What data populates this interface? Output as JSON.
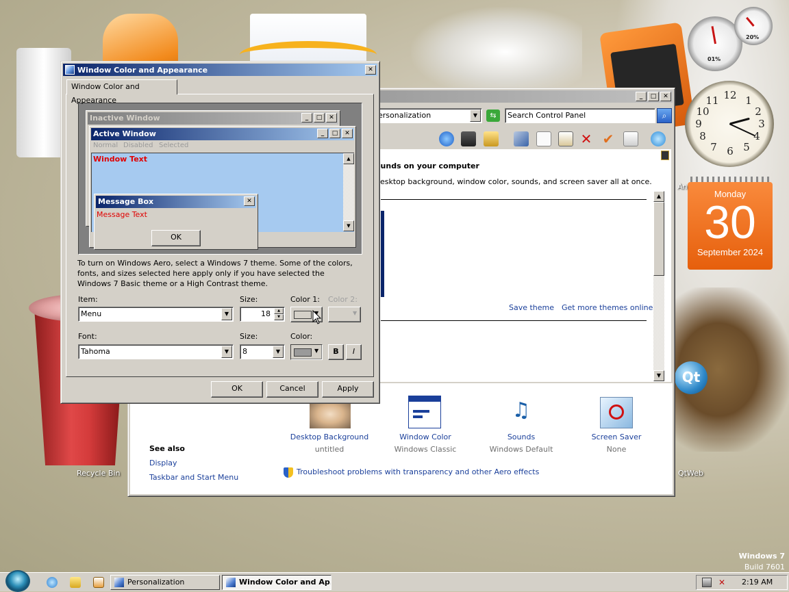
{
  "desktop": {
    "icons": [
      {
        "label": "Recycle Bin"
      },
      {
        "label": "QtWeb"
      }
    ],
    "partial_label": "An",
    "watermark": {
      "line1": "Windows 7",
      "line2": "Build 7601"
    }
  },
  "gadgets": {
    "cpu_percent": "01%",
    "memory_percent": "20%",
    "clock": {
      "numerals": [
        "12",
        "1",
        "2",
        "3",
        "4",
        "5",
        "6",
        "7",
        "8",
        "9",
        "10",
        "11"
      ]
    },
    "calendar": {
      "weekday": "Monday",
      "day": "30",
      "month_year": "September 2024"
    }
  },
  "personalization": {
    "address_text": "ersonalization",
    "search_placeholder": "Search Control Panel",
    "heading": "ounds on your computer",
    "subtext": "desktop background, window color, sounds, and screen saver all at once.",
    "save_theme": "Save theme",
    "get_more_themes": "Get more themes online",
    "items": [
      {
        "label": "Desktop Background",
        "sub": "untitled"
      },
      {
        "label": "Window Color",
        "sub": "Windows Classic"
      },
      {
        "label": "Sounds",
        "sub": "Windows Default"
      },
      {
        "label": "Screen Saver",
        "sub": "None"
      }
    ],
    "see_also_title": "See also",
    "see_also_links": [
      "Display",
      "Taskbar and Start Menu"
    ],
    "troubleshoot": "Troubleshoot problems with transparency and other Aero effects"
  },
  "dialog": {
    "title": "Window Color and Appearance",
    "tab": "Window Color and Appearance",
    "preview": {
      "inactive_title": "Inactive Window",
      "active_title": "Active Window",
      "menu": [
        "Normal",
        "Disabled",
        "Selected"
      ],
      "window_text": "Window Text",
      "msgbox_title": "Message Box",
      "msgbox_text": "Message Text",
      "msgbox_ok": "OK"
    },
    "description": "To turn on Windows Aero, select a Windows 7 theme.  Some of the colors, fonts, and sizes selected here apply only if you have selected the Windows 7 Basic theme or a High Contrast theme.",
    "labels": {
      "item": "Item:",
      "size": "Size:",
      "color1": "Color 1:",
      "color2": "Color 2:",
      "font": "Font:",
      "size2": "Size:",
      "color": "Color:"
    },
    "item_value": "Menu",
    "item_size": "18",
    "font_value": "Tahoma",
    "font_size": "8",
    "bold": "B",
    "italic": "I",
    "buttons": {
      "ok": "OK",
      "cancel": "Cancel",
      "apply": "Apply"
    }
  },
  "taskbar": {
    "buttons": [
      {
        "label": "Personalization"
      },
      {
        "label": "Window Color and Ap..."
      }
    ],
    "time": "2:19 AM"
  },
  "colors": {
    "active_title_start": "#0a246a",
    "active_title_end": "#a6caf0",
    "window_text": "#e00000",
    "preview_client": "#a6caf0",
    "face": "#d4d0c8"
  }
}
